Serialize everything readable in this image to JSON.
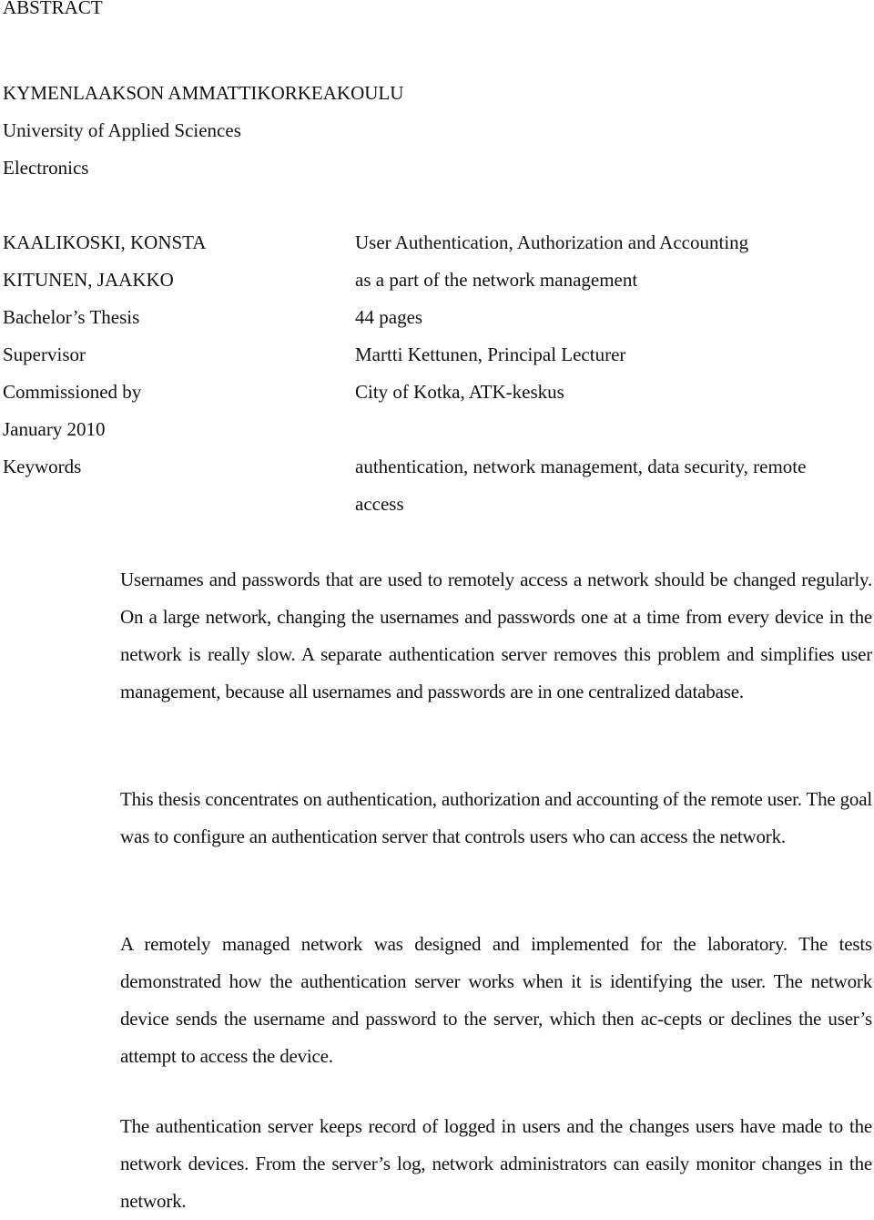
{
  "heading": "ABSTRACT",
  "institution": {
    "name": "KYMENLAAKSON AMMATTIKORKEAKOULU",
    "subtitle": "University of Applied Sciences",
    "department": "Electronics"
  },
  "metadata": {
    "labels": [
      "KAALIKOSKI, KONSTA",
      "KITUNEN, JAAKKO",
      "Bachelor’s Thesis",
      "Supervisor",
      "Commissioned by",
      "January 2010",
      "Keywords"
    ],
    "values": [
      "User Authentication, Authorization and Accounting",
      "as a part of the network management",
      "44 pages",
      "Martti Kettunen, Principal Lecturer",
      "City of Kotka, ATK-keskus",
      "authentication, network management, data security, remote",
      "access"
    ]
  },
  "paragraphs": [
    "Usernames and passwords that are used to remotely access a network should be changed regularly. On a large network, changing the usernames and passwords one at a time from every device in the network is really slow. A separate authentication server removes this problem and simplifies user management, because all usernames and passwords are in one centralized database.",
    "This thesis concentrates on authentication, authorization and accounting of the remote user. The goal was to configure an authentication server that controls users who can access the network.",
    "A remotely managed network was designed and implemented for the laboratory. The tests demonstrated how the authentication server works when it is identifying the user. The network device sends the username and password to the server, which then ac-cepts or declines the user’s attempt to access the device.",
    "The authentication server keeps record of logged in users and the changes users have made to the network devices. From the server’s log, network administrators can easily monitor changes in the network."
  ]
}
